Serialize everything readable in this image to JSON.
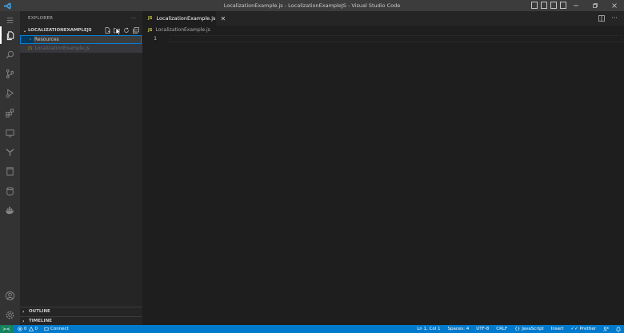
{
  "window": {
    "title": "LocalizationExample.js - LocalizationExampleJS - Visual Studio Code",
    "controls": [
      "minimize",
      "restore",
      "close"
    ]
  },
  "activity_bar": {
    "items": [
      "explorer",
      "search",
      "source-control",
      "run-debug",
      "extensions",
      "remote-explorer",
      "git-graph",
      "bookmarks",
      "database",
      "docker"
    ],
    "bottom": [
      "accounts",
      "manage"
    ]
  },
  "sidebar": {
    "title": "EXPLORER",
    "more": "···",
    "folder_name": "LOCALIZATIONEXAMPLEJS",
    "rename_value": "Resources",
    "files": [
      {
        "badge": "JS",
        "name": "LocalizationExample.js"
      }
    ],
    "sections": [
      {
        "label": "OUTLINE"
      },
      {
        "label": "TIMELINE"
      }
    ]
  },
  "editor": {
    "tab": {
      "badge": "JS",
      "label": "LocalizationExample.js",
      "close": "✕"
    },
    "breadcrumb": {
      "badge": "JS",
      "label": "LocalizationExample.js"
    },
    "line_numbers": [
      "1"
    ]
  },
  "status_bar": {
    "remote_icon": "><",
    "errors": "0",
    "warnings": "0",
    "connect": "Connect",
    "position": "Ln 1, Col 1",
    "spaces": "Spaces: 4",
    "encoding": "UTF-8",
    "eol": "CRLF",
    "language": "JavaScript",
    "mode": "Insert",
    "formatter": "Prettier"
  },
  "colors": {
    "accent": "#007acc",
    "remote": "#16825d",
    "js": "#cbcb41"
  }
}
